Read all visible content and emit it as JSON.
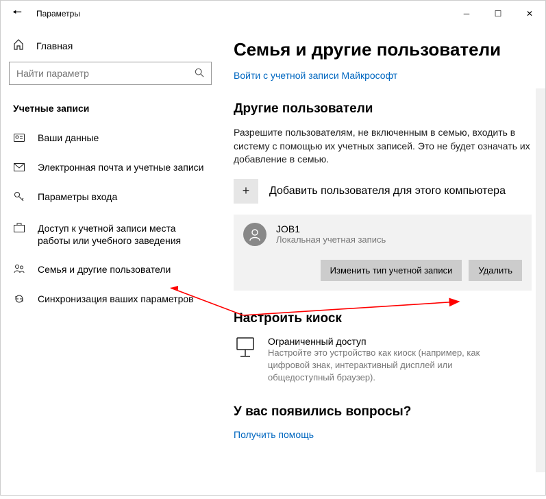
{
  "titlebar": {
    "title": "Параметры"
  },
  "sidebar": {
    "home": "Главная",
    "search_placeholder": "Найти параметр",
    "section": "Учетные записи",
    "items": [
      {
        "label": "Ваши данные"
      },
      {
        "label": "Электронная почта и учетные записи"
      },
      {
        "label": "Параметры входа"
      },
      {
        "label": "Доступ к учетной записи места работы или учебного заведения"
      },
      {
        "label": "Семья и другие пользователи"
      },
      {
        "label": "Синхронизация ваших параметров"
      }
    ]
  },
  "content": {
    "page_title": "Семья и другие пользователи",
    "signin_link": "Войти с учетной записи Майкрософт",
    "other_users_heading": "Другие пользователи",
    "other_users_desc": "Разрешите пользователям, не включенным в семью, входить в систему с помощью их учетных записей. Это не будет означать их добавление в семью.",
    "add_user_label": "Добавить пользователя для этого компьютера",
    "user": {
      "name": "JOB1",
      "sub": "Локальная учетная запись",
      "change_btn": "Изменить тип учетной записи",
      "delete_btn": "Удалить"
    },
    "kiosk_heading": "Настроить киоск",
    "kiosk_title": "Ограниченный доступ",
    "kiosk_desc": "Настройте это устройство как киоск (например, как цифровой знак, интерактивный дисплей или общедоступный браузер).",
    "questions_heading": "У вас появились вопросы?",
    "help_link": "Получить помощь"
  }
}
